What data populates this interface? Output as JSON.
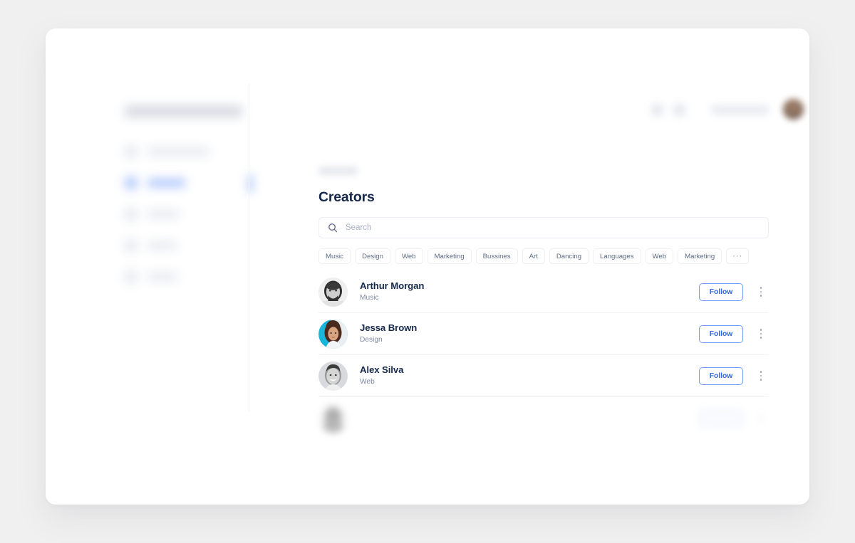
{
  "app": {
    "background_color": "#f0f0f0",
    "card_color": "#ffffff",
    "accent_color": "#2f68e8",
    "heading_color": "#17294b"
  },
  "sidebar": {
    "logo_label": "",
    "active_index": 1,
    "items": [
      {
        "label": "",
        "icon": "dashboard-icon"
      },
      {
        "label": "",
        "icon": "creators-icon"
      },
      {
        "label": "",
        "icon": "courses-icon"
      },
      {
        "label": "",
        "icon": "stats-icon"
      },
      {
        "label": "",
        "icon": "settings-icon"
      }
    ]
  },
  "topbar": {
    "icons": [
      "search-icon",
      "notifications-icon"
    ],
    "pill_label": "",
    "avatar_label": ""
  },
  "main": {
    "breadcrumb": "",
    "title": "Creators",
    "search": {
      "value": "",
      "placeholder": "Search",
      "icon": "search-icon"
    },
    "chips": [
      {
        "label": "Music"
      },
      {
        "label": "Design"
      },
      {
        "label": "Web"
      },
      {
        "label": "Marketing"
      },
      {
        "label": "Bussines"
      },
      {
        "label": "Art"
      },
      {
        "label": "Dancing"
      },
      {
        "label": "Languages"
      },
      {
        "label": "Web"
      },
      {
        "label": "Marketing"
      },
      {
        "label": "···"
      }
    ],
    "creators": [
      {
        "name": "Arthur Morgan",
        "category": "Music",
        "follow_label": "Follow",
        "avatar_style": "grayscale-male-beard",
        "faded": false
      },
      {
        "name": "Jessa Brown",
        "category": "Design",
        "follow_label": "Follow",
        "avatar_style": "color-female-teal",
        "faded": false
      },
      {
        "name": "Alex Silva",
        "category": "Web",
        "follow_label": "Follow",
        "avatar_style": "grayscale-male-smiling",
        "faded": false
      },
      {
        "name": "",
        "category": "",
        "follow_label": "",
        "avatar_style": "blurred",
        "faded": true
      }
    ]
  }
}
